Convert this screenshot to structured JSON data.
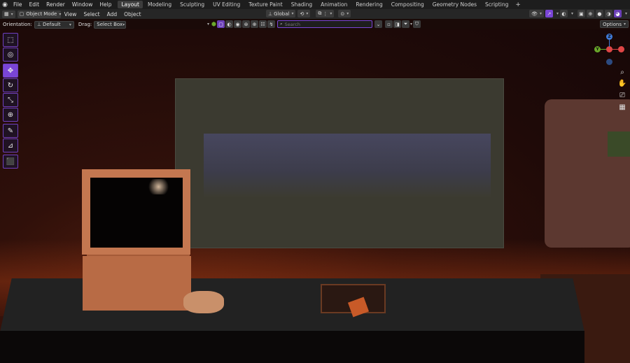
{
  "topbar": {
    "menus": [
      "File",
      "Edit",
      "Render",
      "Window",
      "Help"
    ],
    "workspaces": [
      "Layout",
      "Modeling",
      "Sculpting",
      "UV Editing",
      "Texture Paint",
      "Shading",
      "Animation",
      "Rendering",
      "Compositing",
      "Geometry Nodes",
      "Scripting"
    ],
    "active_workspace": "Layout",
    "add_workspace": "+"
  },
  "header": {
    "mode": "Object Mode",
    "menus": [
      "View",
      "Select",
      "Add",
      "Object"
    ],
    "transform_orientation": "Global"
  },
  "tool_settings": {
    "orientation_label": "Orientation:",
    "orientation_value": "Default",
    "drag_label": "Drag:",
    "drag_value": "Select Box",
    "search_placeholder": "Search",
    "options_label": "Options"
  },
  "gizmo": {
    "z_label": "Z",
    "y_label": "Y",
    "colors": {
      "x": "#e04646",
      "y": "#6aa82a",
      "z": "#3f7ad8"
    }
  },
  "left_tools": [
    {
      "name": "select-box-tool",
      "icon": "select-box-icon",
      "glyph": "⬚",
      "active": false
    },
    {
      "name": "cursor-tool",
      "icon": "cursor-icon",
      "glyph": "◎",
      "active": false
    },
    {
      "name": "move-tool",
      "icon": "move-icon",
      "glyph": "✥",
      "active": true
    },
    {
      "name": "rotate-tool",
      "icon": "rotate-icon",
      "glyph": "↻",
      "active": false
    },
    {
      "name": "scale-tool",
      "icon": "scale-icon",
      "glyph": "⤡",
      "active": false
    },
    {
      "name": "transform-tool",
      "icon": "transform-icon",
      "glyph": "⊕",
      "active": false
    },
    {
      "name": "annotate-tool",
      "icon": "annotate-icon",
      "glyph": "✎",
      "active": false
    },
    {
      "name": "measure-tool",
      "icon": "measure-icon",
      "glyph": "📐",
      "active": false
    },
    {
      "name": "add-cube-tool",
      "icon": "add-cube-icon",
      "glyph": "⬛",
      "active": false
    }
  ],
  "accent_color": "#7a45d6"
}
